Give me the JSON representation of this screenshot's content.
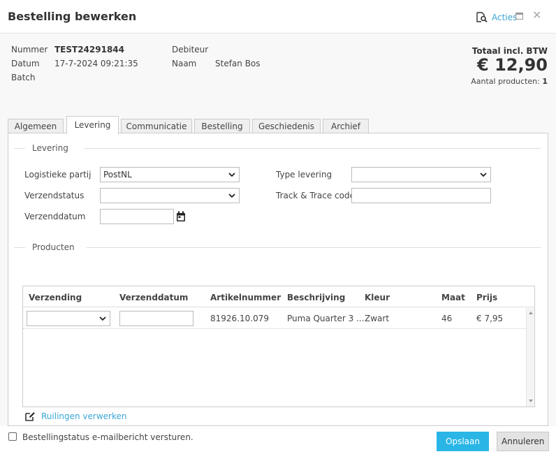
{
  "dialog": {
    "title": "Bestelling bewerken",
    "actions_label": "Acties"
  },
  "header": {
    "number_label": "Nummer",
    "number_value": "TEST24291844",
    "date_label": "Datum",
    "date_value": "17-7-2024 09:21:35",
    "batch_label": "Batch",
    "debtor_label": "Debiteur",
    "name_label": "Naam",
    "name_value": "Stefan Bos",
    "total_label": "Totaal incl. BTW",
    "total_amount": "€ 12,90",
    "product_count_label": "Aantal producten:",
    "product_count_value": "1"
  },
  "tabs": [
    {
      "label": "Algemeen"
    },
    {
      "label": "Levering"
    },
    {
      "label": "Communicatie"
    },
    {
      "label": "Bestelling"
    },
    {
      "label": "Geschiedenis"
    },
    {
      "label": "Archief"
    }
  ],
  "delivery": {
    "section_title": "Levering",
    "logistics_label": "Logistieke partij",
    "logistics_value": "PostNL",
    "shipping_status_label": "Verzendstatus",
    "shipping_status_value": "",
    "shipping_date_label": "Verzenddatum",
    "delivery_type_label": "Type levering",
    "delivery_type_value": "",
    "track_trace_label": "Track & Trace code"
  },
  "products": {
    "section_title": "Producten",
    "columns": [
      "Verzending",
      "Verzenddatum",
      "Artikelnummer",
      "Beschrijving",
      "Kleur",
      "Maat",
      "Prijs"
    ],
    "rows": [
      {
        "shipment": "",
        "ship_date": "",
        "article_number": "81926.10.079",
        "description": "Puma Quarter 3 ...",
        "color": "Zwart",
        "size": "46",
        "price": "€ 7,95"
      }
    ],
    "exchange_link": "Ruilingen verwerken"
  },
  "footer": {
    "email_checkbox_label": "Bestellingstatus e-mailbericht versturen.",
    "save_label": "Opslaan",
    "cancel_label": "Annuleren"
  },
  "colors": {
    "accent": "#29b6e6",
    "link": "#3aa6d6"
  }
}
